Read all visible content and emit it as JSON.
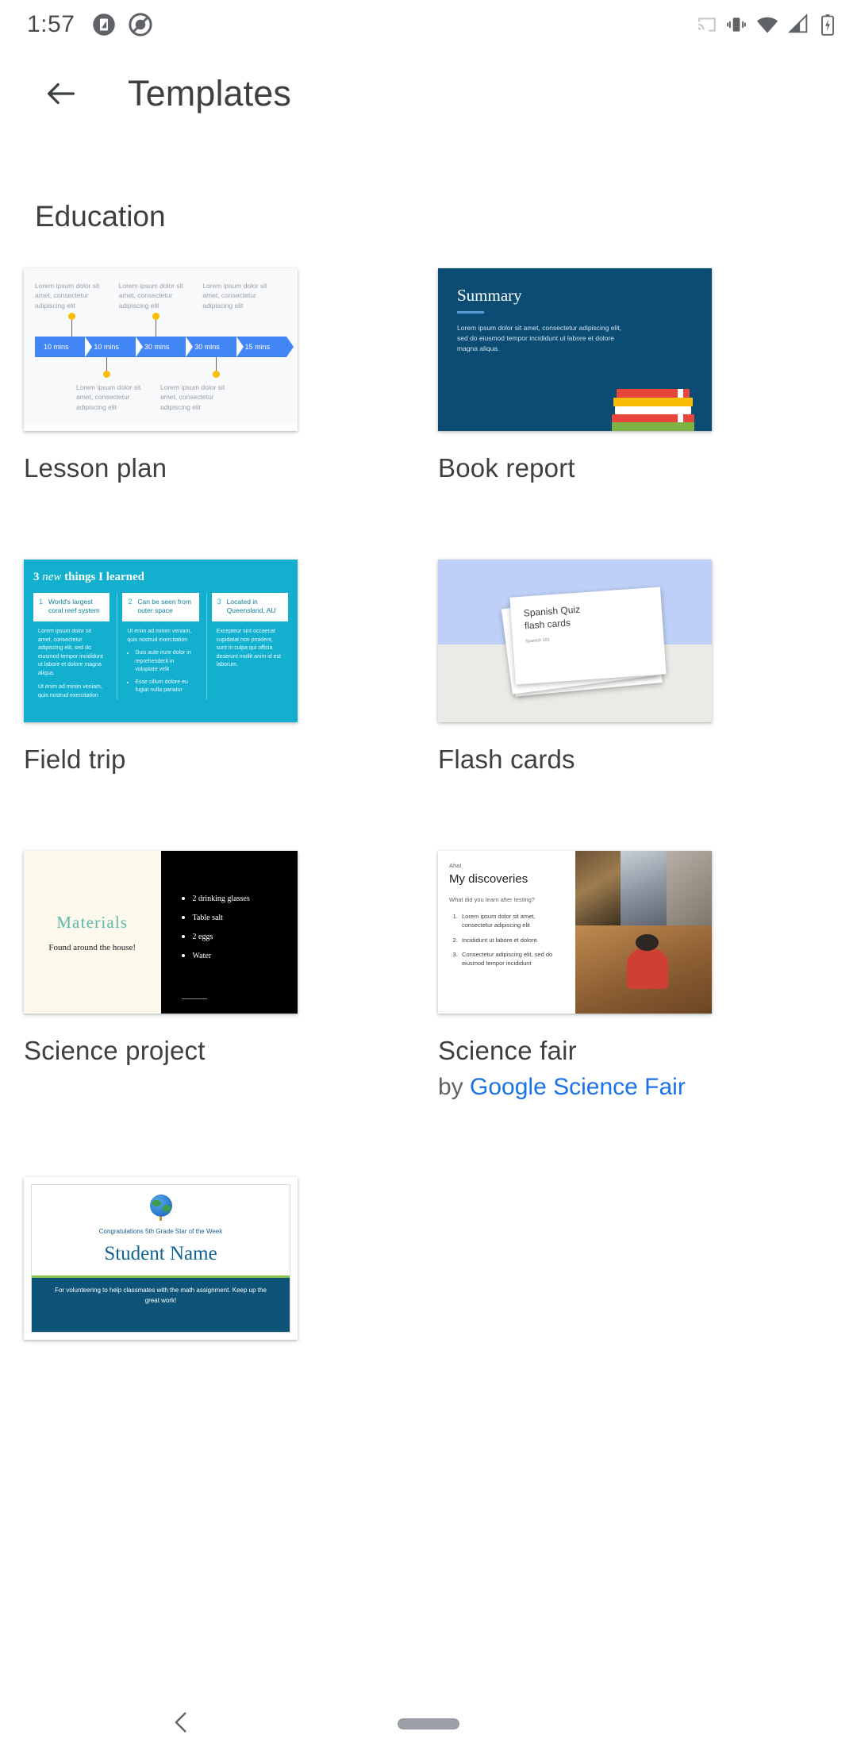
{
  "status_bar": {
    "time": "1:57",
    "left_icons": [
      "screenshot-icon",
      "do-not-disturb-icon"
    ],
    "right_icons": [
      "cast-icon",
      "vibrate-icon",
      "wifi-icon",
      "signal-icon",
      "battery-charging-icon"
    ]
  },
  "app_bar": {
    "back_icon": "back-arrow-icon",
    "title": "Templates"
  },
  "section": {
    "title": "Education"
  },
  "templates": [
    {
      "name": "Lesson plan",
      "thumb": {
        "notes_top": [
          "Lorem ipsum dolor sit amet, consectetur adipiscing elit",
          "Lorem ipsum dolor sit amet, consectetur adipiscing elit",
          "Lorem ipsum dolor sit amet, consectetur adipiscing elit"
        ],
        "segments": [
          "10 mins",
          "10 mins",
          "30 mins",
          "30 mins",
          "15 mins"
        ],
        "notes_bottom": [
          "Lorem ipsum dolor sit amet, consectetur adipiscing elit",
          "Lorem ipsum dolor sit amet, consectetur adipiscing elit"
        ],
        "segment_color": "#4285f4",
        "dot_color": "#fbbc04"
      }
    },
    {
      "name": "Book report",
      "thumb": {
        "title": "Summary",
        "body": "Lorem ipsum dolor sit amet, consectetur adipiscing elit, sed do eiusmod tempor incididunt ut labore et dolore magna aliqua.",
        "bg_color": "#0b4c75",
        "illustration": "stack-of-books-icon"
      }
    },
    {
      "name": "Field trip",
      "thumb": {
        "title_pre": "3 ",
        "title_em": "new",
        "title_post": " things I learned",
        "bg_color": "#12b0ce",
        "columns": [
          {
            "num": "1",
            "chip": "World's largest coral reef system",
            "paras": [
              "Lorem ipsum dolor sit amet, consectetur adipiscing elit, sed do eiusmod tempor incididunt ut labore et dolore magna aliqua.",
              "Ut enim ad minim veniam, quis nostrud exercitation"
            ],
            "bullets": []
          },
          {
            "num": "2",
            "chip": "Can be seen from outer space",
            "paras": [
              "Ut enim ad minim veniam, quis nostrud exercitation"
            ],
            "bullets": [
              "Duis aute irure dolor in reprehenderit in voluptate velit",
              "Esse cillum dolore eu fugiat nulla pariatur"
            ]
          },
          {
            "num": "3",
            "chip": "Located in Queensland, AU",
            "paras": [
              "Excepteur sint occaecat cupidatat non proident, sunt in culpa qui officia deserunt mollit anim id est laborum."
            ],
            "bullets": []
          }
        ]
      }
    },
    {
      "name": "Flash cards",
      "thumb": {
        "card_title_line1": "Spanish Quiz",
        "card_title_line2": "flash cards",
        "card_subtitle": "Spanish 101",
        "sky_color": "#bed0f7",
        "table_color": "#eceae6"
      }
    },
    {
      "name": "Science project",
      "thumb": {
        "heading": "Materials",
        "subheading": "Found around the house!",
        "items": [
          "2 drinking glasses",
          "Table salt",
          "2 eggs",
          "Water"
        ],
        "left_bg": "#fdf8ec",
        "right_bg": "#000000",
        "heading_color": "#5bb9ae"
      }
    },
    {
      "name": "Science fair",
      "by_prefix": "by ",
      "by_link": "Google Science Fair",
      "thumb": {
        "eyebrow": "Aha!",
        "heading": "My discoveries",
        "question": "What did you learn after testing?",
        "items": [
          "Lorem ipsum dolor sit amet, consectetur adipiscing elit",
          "Incididunt ut labore et dolore",
          "Consectetur adipiscing elit, sed do eiusmod tempor incididunt"
        ]
      }
    },
    {
      "name": "",
      "thumb": {
        "congrats": "Congratulations 5th Grade Star of the Week",
        "student_name": "Student Name",
        "band_text": "For volunteering to help classmates with the math assignment. Keep up the great work!",
        "accent_green": "#8bc34a",
        "band_color": "#0e5378",
        "icon": "globe-icon"
      }
    }
  ],
  "nav_bar": {
    "back_icon": "nav-back-icon",
    "home_pill": "home-pill"
  }
}
